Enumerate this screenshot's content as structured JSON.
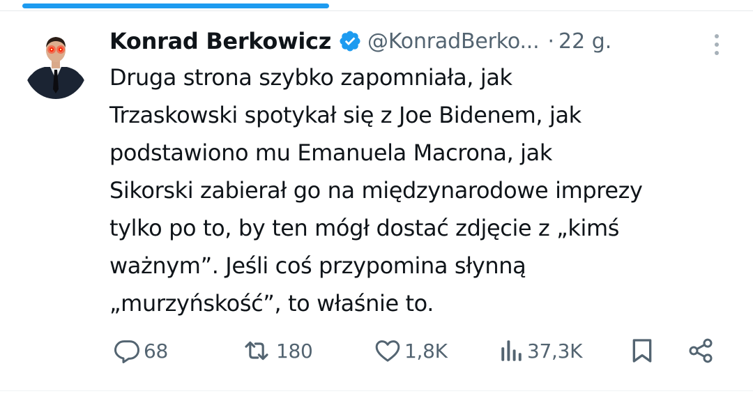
{
  "progress": {
    "fraction": 0.42,
    "color": "#1d9bf0"
  },
  "author": {
    "display_name": "Konrad Berkowicz",
    "handle": "@KonradBerko...",
    "separator": "·",
    "time": "22 g.",
    "verified": true,
    "verified_color": "#1d9bf0"
  },
  "icons": {
    "avatar": "avatar-photo",
    "verified": "verified-badge-icon",
    "more": "more-vertical-icon",
    "reply": "reply-icon",
    "retweet": "retweet-icon",
    "like": "heart-icon",
    "views": "views-bar-chart-icon",
    "bookmark": "bookmark-icon",
    "share": "share-icon"
  },
  "tweet": {
    "text": "Druga strona szybko zapomniała, jak\nTrzaskowski spotykał się z Joe Bidenem, jak\npodstawiono mu Emanuela Macrona, jak\nSikorski zabierał go na międzynarodowe imprezy\ntylko po to, by ten mógł dostać zdjęcie z „kimś\nważnym”. Jeśli coś przypomina słynną\n„murzyńskość”, to właśnie to."
  },
  "actions": {
    "replies": "68",
    "retweets": "180",
    "likes": "1,8K",
    "views": "37,3K"
  },
  "colors": {
    "text": "#0f1419",
    "secondary": "#536471",
    "accent": "#1d9bf0"
  }
}
